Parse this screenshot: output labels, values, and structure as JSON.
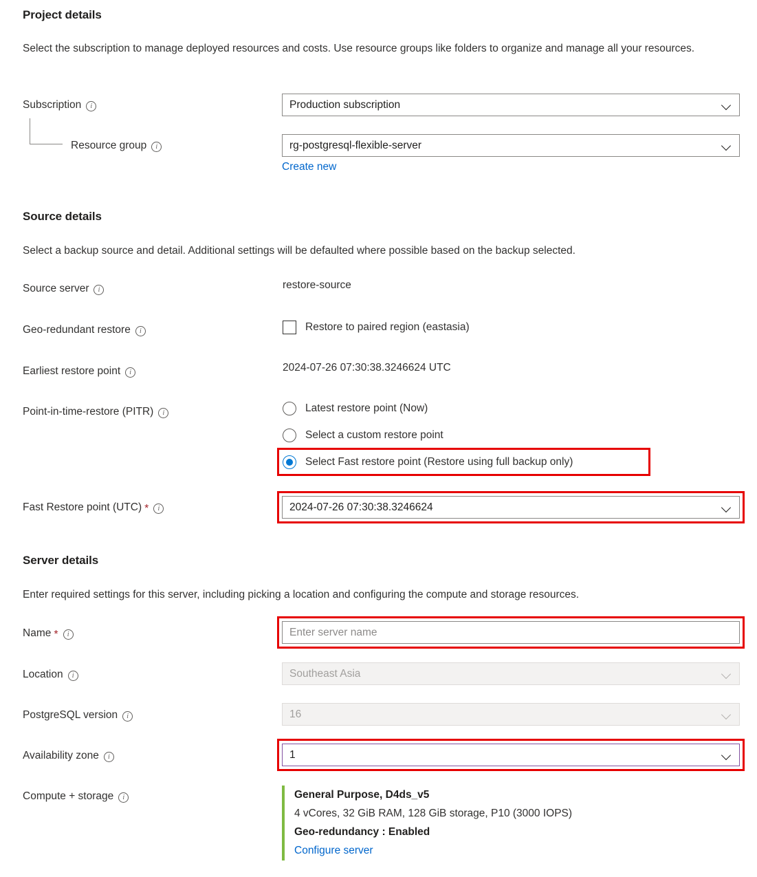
{
  "project_details": {
    "title": "Project details",
    "description": "Select the subscription to manage deployed resources and costs. Use resource groups like folders to organize and manage all your resources.",
    "subscription": {
      "label": "Subscription",
      "value": "Production subscription"
    },
    "resource_group": {
      "label": "Resource group",
      "value": "rg-postgresql-flexible-server",
      "create_new_link": "Create new"
    }
  },
  "source_details": {
    "title": "Source details",
    "description": "Select a backup source and detail. Additional settings will be defaulted where possible based on the backup selected.",
    "source_server": {
      "label": "Source server",
      "value": "restore-source"
    },
    "geo_redundant_restore": {
      "label": "Geo-redundant restore",
      "checkbox_label": "Restore to paired region (eastasia)",
      "checked": false
    },
    "earliest_restore_point": {
      "label": "Earliest restore point",
      "value": "2024-07-26 07:30:38.3246624 UTC"
    },
    "pitr": {
      "label": "Point-in-time-restore (PITR)",
      "options": [
        {
          "label": "Latest restore point (Now)",
          "selected": false
        },
        {
          "label": "Select a custom restore point",
          "selected": false
        },
        {
          "label": "Select Fast restore point (Restore using full backup only)",
          "selected": true
        }
      ]
    },
    "fast_restore_point": {
      "label": "Fast Restore point (UTC)",
      "required_marker": "*",
      "value": "2024-07-26 07:30:38.3246624"
    }
  },
  "server_details": {
    "title": "Server details",
    "description": "Enter required settings for this server, including picking a location and configuring the compute and storage resources.",
    "name": {
      "label": "Name",
      "required_marker": "*",
      "placeholder": "Enter server name",
      "value": ""
    },
    "location": {
      "label": "Location",
      "value": "Southeast Asia",
      "disabled": true
    },
    "postgresql_version": {
      "label": "PostgreSQL version",
      "value": "16",
      "disabled": true
    },
    "availability_zone": {
      "label": "Availability zone",
      "value": "1"
    },
    "compute_storage": {
      "label": "Compute + storage",
      "tier": "General Purpose, D4ds_v5",
      "specs": "4 vCores, 32 GiB RAM, 128 GiB storage, P10 (3000 IOPS)",
      "geo_redundancy": "Geo-redundancy : Enabled",
      "configure_link": "Configure server"
    }
  },
  "colors": {
    "accent_blue": "#0078d4",
    "link_blue": "#0066cc",
    "annotation_red": "#e60000",
    "focus_purple": "#8250a0",
    "compute_bar_green": "#7fba42",
    "required_red": "#a4262c"
  }
}
